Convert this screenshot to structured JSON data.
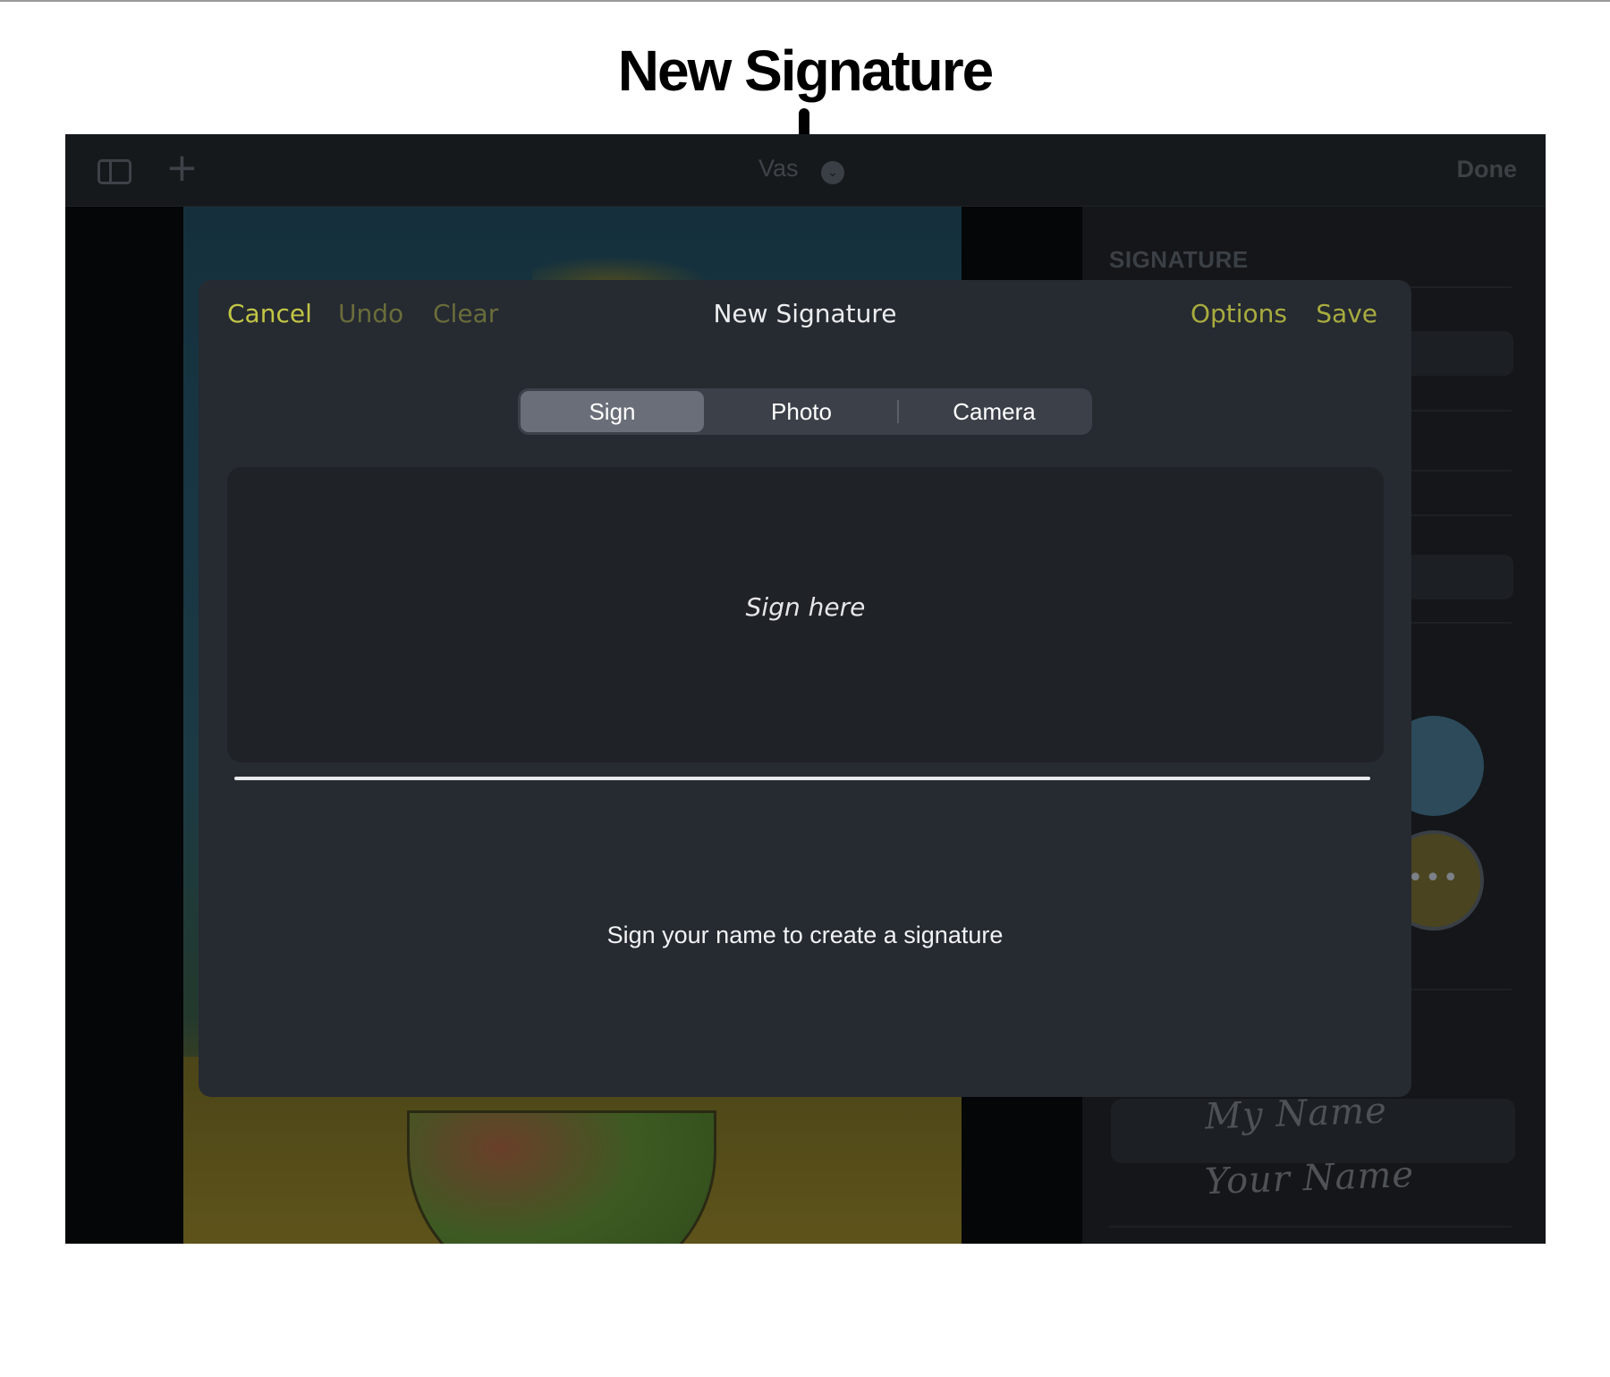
{
  "callout": {
    "title": "New Signature"
  },
  "toolbar": {
    "document_title": "Vas",
    "done_label": "Done"
  },
  "side_panel": {
    "heading": "SIGNATURE",
    "more_glyph": "•••",
    "saved_signatures": [
      "My Name",
      "Your Name"
    ]
  },
  "modal": {
    "title": "New Signature",
    "cancel_label": "Cancel",
    "undo_label": "Undo",
    "clear_label": "Clear",
    "options_label": "Options",
    "save_label": "Save",
    "tabs": [
      {
        "label": "Sign",
        "selected": true
      },
      {
        "label": "Photo",
        "selected": false
      },
      {
        "label": "Camera",
        "selected": false
      }
    ],
    "sign_placeholder": "Sign here",
    "instructions": "Sign your name to create a signature"
  },
  "colors": {
    "accent": "#c2c644",
    "accent_disabled": "#6a6d3a",
    "modal_bg": "#262a31",
    "segment_selected": "#6a6e78"
  },
  "icons": {
    "toolbar_left": "sidebar-icon",
    "toolbar_add": "plus-icon",
    "title_menu": "chevron-down-icon",
    "more": "ellipsis-icon"
  }
}
